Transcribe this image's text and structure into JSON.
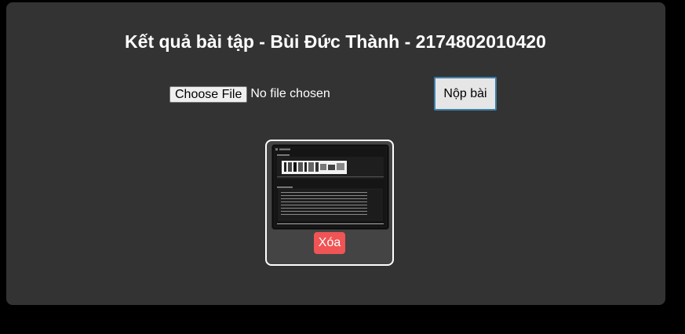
{
  "page": {
    "title": "Kết quả bài tập - Bùi Đức Thành - 2174802010420"
  },
  "upload": {
    "choose_file_label": "Choose File",
    "file_status": "No file chosen",
    "submit_label": "Nộp bài"
  },
  "submission": {
    "thumbnail_icon": "document-screenshot-thumbnail",
    "delete_label": "Xóa",
    "delete_color": "#f05454"
  },
  "colors": {
    "page_background": "#000000",
    "panel_background": "#333333",
    "card_border": "#ffffff",
    "submit_border": "#3d7faa"
  }
}
